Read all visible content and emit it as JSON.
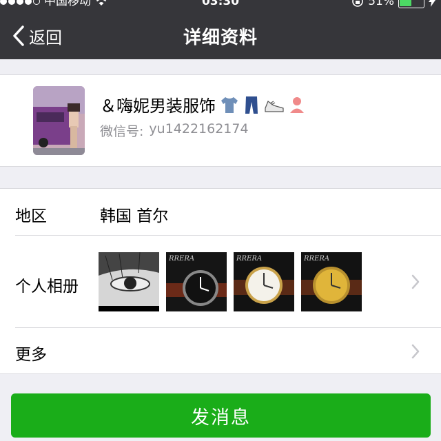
{
  "status_bar": {
    "carrier": "中国移动",
    "time": "03:30",
    "battery_percent": "51%",
    "battery_level": 0.51
  },
  "nav": {
    "back_label": "返回",
    "title": "详细资料"
  },
  "profile": {
    "name": "＆嗨妮男装服饰",
    "emoji_icons": [
      "shirt-icon",
      "jeans-icon",
      "sneaker-icon",
      "person-icon"
    ],
    "wechat_label": "微信号:",
    "wechat_id": "yu1422162174"
  },
  "info": {
    "region_label": "地区",
    "region_value": "韩国 首尔",
    "album_label": "个人相册",
    "more_label": "更多"
  },
  "album_photos": [
    {
      "subject": "eye-photo"
    },
    {
      "subject": "black-watch-photo",
      "brand_text": "RRERA"
    },
    {
      "subject": "white-watch-photo",
      "brand_text": "RRERA"
    },
    {
      "subject": "gold-watch-photo",
      "brand_text": "RRERA"
    }
  ],
  "actions": {
    "send_message": "发消息"
  },
  "colors": {
    "nav_bg": "#36363a",
    "page_bg": "#efeff4",
    "send_button": "#1aad19",
    "secondary_text": "#8e8e93"
  }
}
